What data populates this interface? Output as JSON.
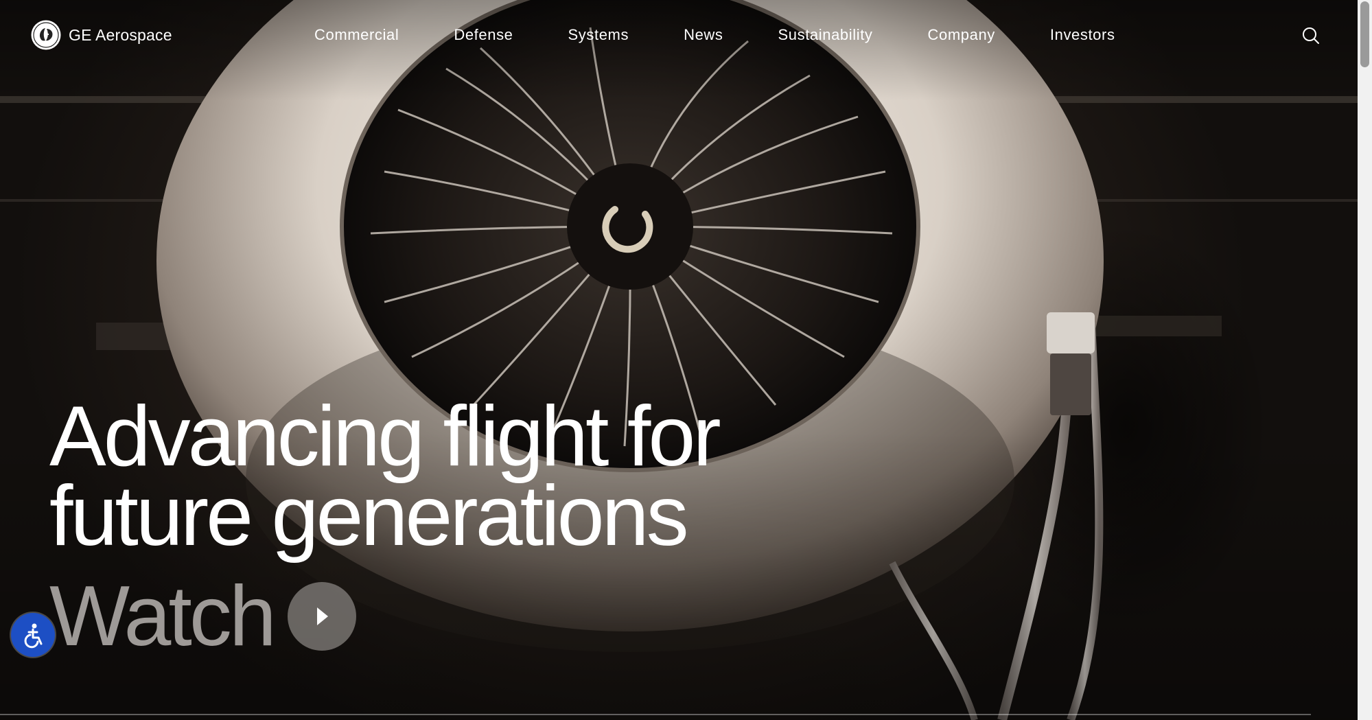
{
  "header": {
    "brand": "GE Aerospace",
    "logo_icon": "ge-monogram-icon",
    "nav": [
      {
        "label": "Commercial"
      },
      {
        "label": "Defense"
      },
      {
        "label": "Systems"
      },
      {
        "label": "News"
      },
      {
        "label": "Sustainability"
      },
      {
        "label": "Company"
      },
      {
        "label": "Investors"
      }
    ],
    "search_icon": "search-icon"
  },
  "hero": {
    "headline_line1": "Advancing flight for",
    "headline_line2": "future generations",
    "watch_label": "Watch",
    "play_icon": "play-icon",
    "image": "jet-engine-fan-photo"
  },
  "accessibility": {
    "icon": "accessibility-icon",
    "color": "#1d4fc4"
  },
  "colors": {
    "text": "#ffffff",
    "watch_text": "#9e9a97",
    "background": "#1a1512"
  }
}
